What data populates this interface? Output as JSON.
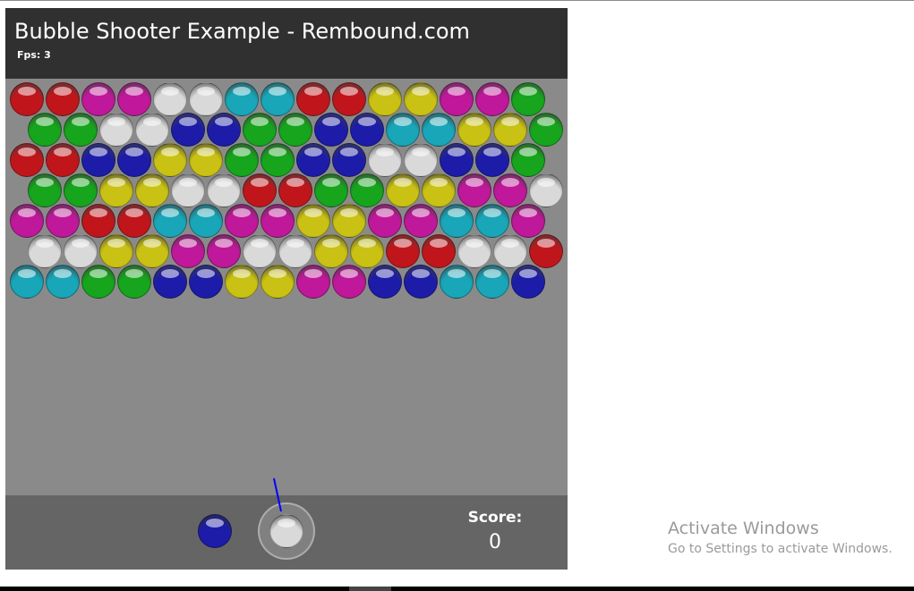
{
  "game": {
    "title": "Bubble Shooter Example - Rembound.com",
    "fps_text": "Fps: 3",
    "score_label": "Score:",
    "score": "0"
  },
  "colors": {
    "red": "#c0161b",
    "magenta": "#c0189a",
    "white": "#d9d9d9",
    "cyan": "#18a6b8",
    "yellow": "#c9c113",
    "green": "#16a51c",
    "blue": "#1c1ca8",
    "background": "#8a8a8a",
    "header": "#303030",
    "footer": "#656565",
    "aim": "#0000ff"
  },
  "grid": [
    [
      "red",
      "red",
      "magenta",
      "magenta",
      "white",
      "white",
      "cyan",
      "cyan",
      "red",
      "red",
      "yellow",
      "yellow",
      "magenta",
      "magenta",
      "green"
    ],
    [
      "green",
      "green",
      "white",
      "white",
      "blue",
      "blue",
      "green",
      "green",
      "blue",
      "blue",
      "cyan",
      "cyan",
      "yellow",
      "yellow",
      "green"
    ],
    [
      "red",
      "red",
      "blue",
      "blue",
      "yellow",
      "yellow",
      "green",
      "green",
      "blue",
      "blue",
      "white",
      "white",
      "blue",
      "blue",
      "green"
    ],
    [
      "green",
      "green",
      "yellow",
      "yellow",
      "white",
      "white",
      "red",
      "red",
      "green",
      "green",
      "yellow",
      "yellow",
      "magenta",
      "magenta",
      "white"
    ],
    [
      "magenta",
      "magenta",
      "red",
      "red",
      "cyan",
      "cyan",
      "magenta",
      "magenta",
      "yellow",
      "yellow",
      "magenta",
      "magenta",
      "cyan",
      "cyan",
      "magenta"
    ],
    [
      "white",
      "white",
      "yellow",
      "yellow",
      "magenta",
      "magenta",
      "white",
      "white",
      "yellow",
      "yellow",
      "red",
      "red",
      "white",
      "white",
      "red"
    ],
    [
      "cyan",
      "cyan",
      "green",
      "green",
      "blue",
      "blue",
      "yellow",
      "yellow",
      "magenta",
      "magenta",
      "blue",
      "blue",
      "cyan",
      "cyan",
      "blue"
    ]
  ],
  "next_bubble": "blue",
  "current_bubble": "white",
  "windows_notice": {
    "title": "Activate Windows",
    "subtitle": "Go to Settings to activate Windows."
  }
}
